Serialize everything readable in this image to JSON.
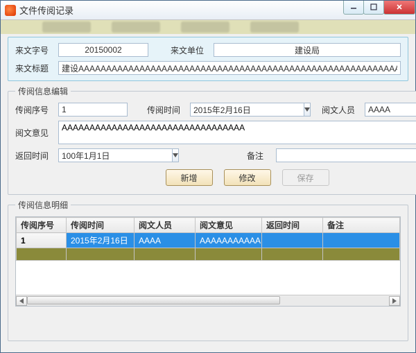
{
  "window": {
    "title": "文件传阅记录"
  },
  "header": {
    "doc_no_label": "来文字号",
    "doc_no": "20150002",
    "sender_label": "来文单位",
    "sender": "建设局",
    "title_label": "来文标题",
    "title_value": "建设AAAAAAAAAAAAAAAAAAAAAAAAAAAAAAAAAAAAAAAAAAAAAAAAAAAAAAAAAAAAAAA"
  },
  "edit": {
    "legend": "传阅信息编辑",
    "seq_label": "传阅序号",
    "seq": "1",
    "time_label": "传阅时间",
    "time": "2015年2月16日",
    "reader_label": "阅文人员",
    "reader": "AAAA",
    "opinion_label": "阅文意见",
    "opinion": "AAAAAAAAAAAAAAAAAAAAAAAAAAAAAAAAA",
    "return_label": "返回时间",
    "return_time": "100年1月1日",
    "remark_label": "备注",
    "remark": ""
  },
  "buttons": {
    "add": "新增",
    "modify": "修改",
    "save": "保存"
  },
  "detail": {
    "legend": "传阅信息明细",
    "cols": [
      "传阅序号",
      "传阅时间",
      "阅文人员",
      "阅文意见",
      "返回时间",
      "备注"
    ],
    "rows": [
      {
        "seq": "1",
        "time": "2015年2月16日",
        "reader": "AAAA",
        "opinion": "AAAAAAAAAAA",
        "return": "",
        "remark": ""
      }
    ]
  }
}
